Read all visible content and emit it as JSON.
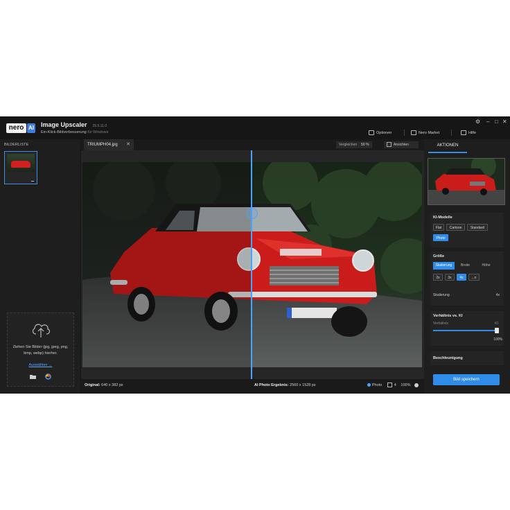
{
  "app": {
    "brand_main": "nero",
    "brand_ai": "AI",
    "title": "Image Upscaler",
    "version": "25.5.11.0",
    "subtitle": "Ein-Klick-Bildverbesserung",
    "subtitle_os": "für Windows",
    "window_controls": [
      "⚙",
      "–",
      "□",
      "✕"
    ]
  },
  "top_menu": {
    "options": "Optionen",
    "market": "Nero Market",
    "help": "Hilfe"
  },
  "sidebar": {
    "title": "BILDERLISTE",
    "drop_text": "Ziehen Sie Bilder (jpg, jpeg, png, bmp, webp) hierher.",
    "drop_link": "Auswählen →",
    "icons": [
      "cloud-upload-icon",
      "folder-icon",
      "google-photos-icon"
    ]
  },
  "tabs": {
    "file_tab": "TRIUMPH04.jpg",
    "close": "✕",
    "vergleich_label": "Vergleichen",
    "vergleich_value": "50 %",
    "ansichten": "Ansichten"
  },
  "status": {
    "original_label": "Original:",
    "original_value": "640 x 382 px",
    "result_label": "AI Photo Ergebnis:",
    "result_value": "2560 x 1528 px",
    "mode": "Photo",
    "count": "4",
    "zoom": "100%"
  },
  "panel": {
    "tab": "AKTIONEN",
    "models_title": "KI-Modelle",
    "models": [
      "Flat",
      "Cartoon",
      "Standard",
      "Photo"
    ],
    "models_selected": "Photo",
    "size_title": "Größe",
    "size_modes": [
      "Skalierung",
      "Breite",
      "Höhe"
    ],
    "size_selected": "Skalierung",
    "scales": [
      "2x",
      "3x",
      "4x",
      "...x"
    ],
    "scale_selected": "4x",
    "scale_label": "Skalierung",
    "scale_value": "4x",
    "ratio_title": "Verhältnis vs. KI",
    "ratio_left": "Verhältnis",
    "ratio_right": "KI",
    "ratio_value": "100%",
    "ratio_fraction": 1.0,
    "sharpen_title": "Beschleunigung",
    "save": "Bild speichern"
  },
  "colors": {
    "accent": "#2f8ce8",
    "background": "#1f1f1f",
    "car": "#d0201f"
  }
}
